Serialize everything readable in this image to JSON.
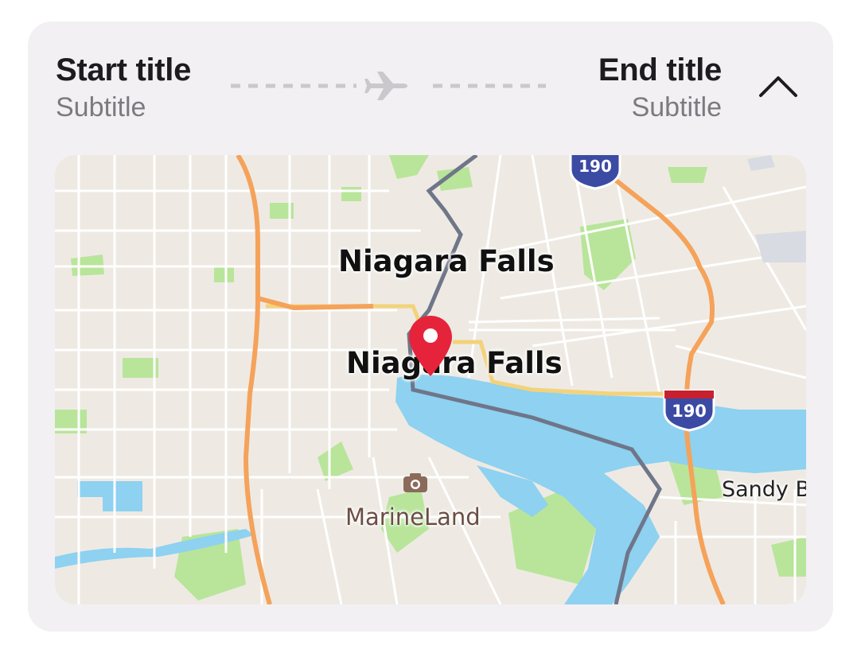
{
  "header": {
    "start_title": "Start title",
    "start_subtitle": "Subtitle",
    "end_title": "End title",
    "end_subtitle": "Subtitle",
    "route_icon": "airplane-icon",
    "collapse_icon": "chevron-up-icon"
  },
  "map": {
    "labels": {
      "city_upper": "Niagara Falls",
      "city_lower": "Niagara Falls",
      "poi": "MarineLand",
      "town": "Sandy B"
    },
    "shields": {
      "interstate_top": "190",
      "interstate_right": "190"
    },
    "icons": [
      "location-pin-icon",
      "camera-icon"
    ]
  },
  "colors": {
    "card_background": "#f2f0f3",
    "title": "#1c1b1f",
    "subtitle": "#7b7a80",
    "water": "#8ed1f0",
    "park": "#b8e59a",
    "highway": "#f5a25a",
    "pin": "#e5243b"
  }
}
